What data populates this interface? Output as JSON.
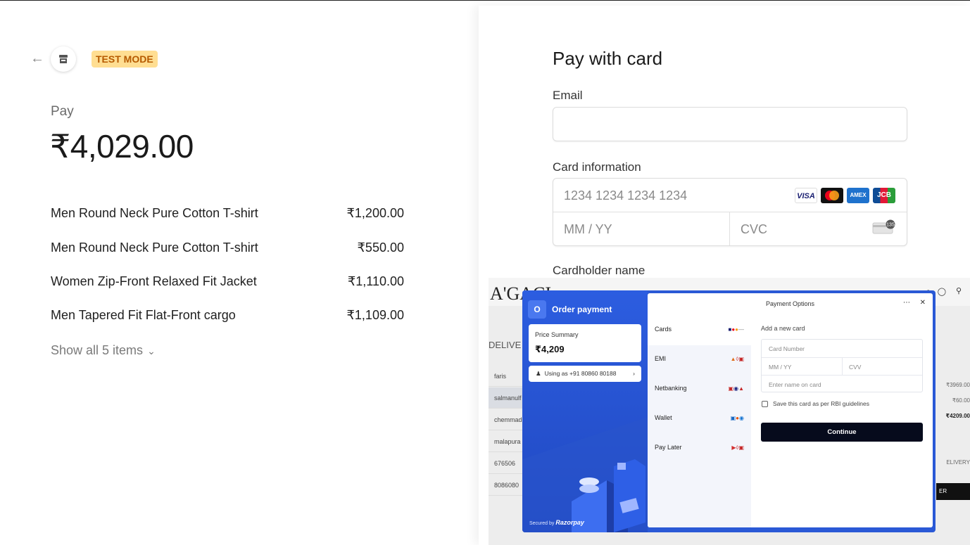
{
  "header": {
    "test_mode": "TEST MODE"
  },
  "summary": {
    "pay_label": "Pay",
    "amount": "₹4,029.00",
    "items": [
      {
        "name": "Men Round Neck Pure Cotton T-shirt",
        "price": "₹1,200.00"
      },
      {
        "name": "Men Round Neck Pure Cotton T-shirt",
        "price": "₹550.00"
      },
      {
        "name": "Women Zip-Front Relaxed Fit Jacket",
        "price": "₹1,110.00"
      },
      {
        "name": "Men Tapered Fit Flat-Front cargo",
        "price": "₹1,109.00"
      }
    ],
    "show_all": "Show all 5 items"
  },
  "form": {
    "title": "Pay with card",
    "email_label": "Email",
    "email_value": "",
    "card_label": "Card information",
    "card_number_placeholder": "1234 1234 1234 1234",
    "expiry_placeholder": "MM / YY",
    "cvc_placeholder": "CVC",
    "cardholder_label": "Cardholder name",
    "brands": [
      "VISA",
      "Mastercard",
      "AMEX",
      "JCB"
    ],
    "cvc_badge": "135"
  },
  "overlay": {
    "store_logo": "A'GACI",
    "bg_delivery": "DELIVE",
    "bg_rows": [
      "faris",
      "salmanulf",
      "chemmad",
      "malapura",
      "676506",
      "8086080"
    ],
    "bg_amounts": [
      "₹3969.00",
      "₹60.00",
      "₹4209.00"
    ],
    "bg_delivery_right": "ELIVERY",
    "bg_button": "ER",
    "razorpay": {
      "badge": "O",
      "title": "Order payment",
      "price_summary_label": "Price Summary",
      "price_summary_value": "₹4,209",
      "using_as": "Using as +91 80860 80188",
      "secured_by": "Secured by",
      "brand": "Razorpay",
      "options_title": "Payment Options",
      "options": [
        {
          "label": "Cards",
          "icons": "visa-mastercard-rupay"
        },
        {
          "label": "EMI",
          "icons": "bank-icons"
        },
        {
          "label": "Netbanking",
          "icons": "bank-icons"
        },
        {
          "label": "Wallet",
          "icons": "wallet-icons"
        },
        {
          "label": "Pay Later",
          "icons": "paylater-icons"
        }
      ],
      "add_new_card": "Add a new card",
      "card_number_placeholder": "Card Number",
      "expiry_placeholder": "MM / YY",
      "cvv_placeholder": "CVV",
      "name_placeholder": "Enter name on card",
      "save_card": "Save this card as per RBI guidelines",
      "continue": "Continue"
    }
  }
}
